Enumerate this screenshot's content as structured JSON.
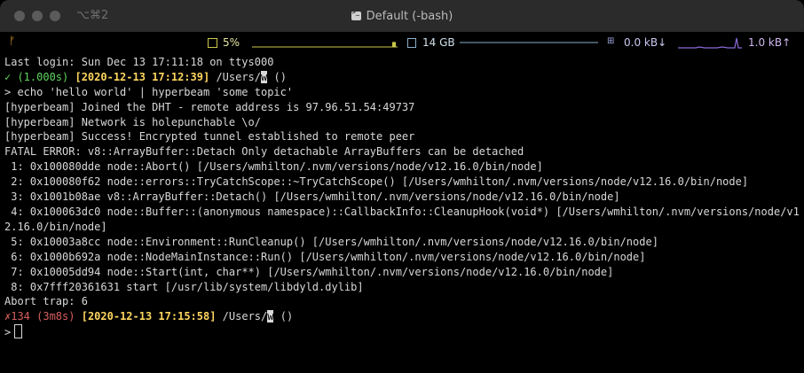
{
  "window": {
    "title": "Default (-bash)",
    "shortcut": "⌥⌘2"
  },
  "statusbar": {
    "git_icon": "branch-icon",
    "cpu_percent": "5%",
    "cpu_level": 0.05,
    "memory": "14 GB",
    "net_down": "0.0 kB↓",
    "net_up": "1.0 kB↑"
  },
  "colors": {
    "success": "#5fd75f",
    "timestamp": "#ffd75f",
    "error": "#d75f5f",
    "text": "#d8d8d8"
  },
  "terminal": {
    "last_login": "Last login: Sun Dec 13 17:11:18 on ttys000",
    "prompt1": {
      "status": "✓ (1.000s)",
      "timestamp": "[2020-12-13 17:12:39]",
      "path": "/Users/",
      "cursor_char": "w",
      "suffix": "()"
    },
    "command": "> echo 'hello world' | hyperbeam 'some topic'",
    "output": [
      "[hyperbeam] Joined the DHT - remote address is 97.96.51.54:49737",
      "[hyperbeam] Network is holepunchable \\o/",
      "[hyperbeam] Success! Encrypted tunnel established to remote peer",
      "FATAL ERROR: v8::ArrayBuffer::Detach Only detachable ArrayBuffers can be detached",
      " 1: 0x100080dde node::Abort() [/Users/wmhilton/.nvm/versions/node/v12.16.0/bin/node]",
      " 2: 0x100080f62 node::errors::TryCatchScope::~TryCatchScope() [/Users/wmhilton/.nvm/versions/node/v12.16.0/bin/node]",
      " 3: 0x1001b08ae v8::ArrayBuffer::Detach() [/Users/wmhilton/.nvm/versions/node/v12.16.0/bin/node]",
      " 4: 0x100063dc0 node::Buffer::(anonymous namespace)::CallbackInfo::CleanupHook(void*) [/Users/wmhilton/.nvm/versions/node/v12.16.0/bin/node]",
      " 5: 0x10003a8cc node::Environment::RunCleanup() [/Users/wmhilton/.nvm/versions/node/v12.16.0/bin/node]",
      " 6: 0x1000b692a node::NodeMainInstance::Run() [/Users/wmhilton/.nvm/versions/node/v12.16.0/bin/node]",
      " 7: 0x10005dd94 node::Start(int, char**) [/Users/wmhilton/.nvm/versions/node/v12.16.0/bin/node]",
      " 8: 0x7fff20361631 start [/usr/lib/system/libdyld.dylib]",
      "Abort trap: 6"
    ],
    "prompt2": {
      "status": "✗134 (3m8s)",
      "timestamp": "[2020-12-13 17:15:58]",
      "path": "/Users/",
      "cursor_char": "w",
      "suffix": "()"
    },
    "input_prompt": ">"
  }
}
